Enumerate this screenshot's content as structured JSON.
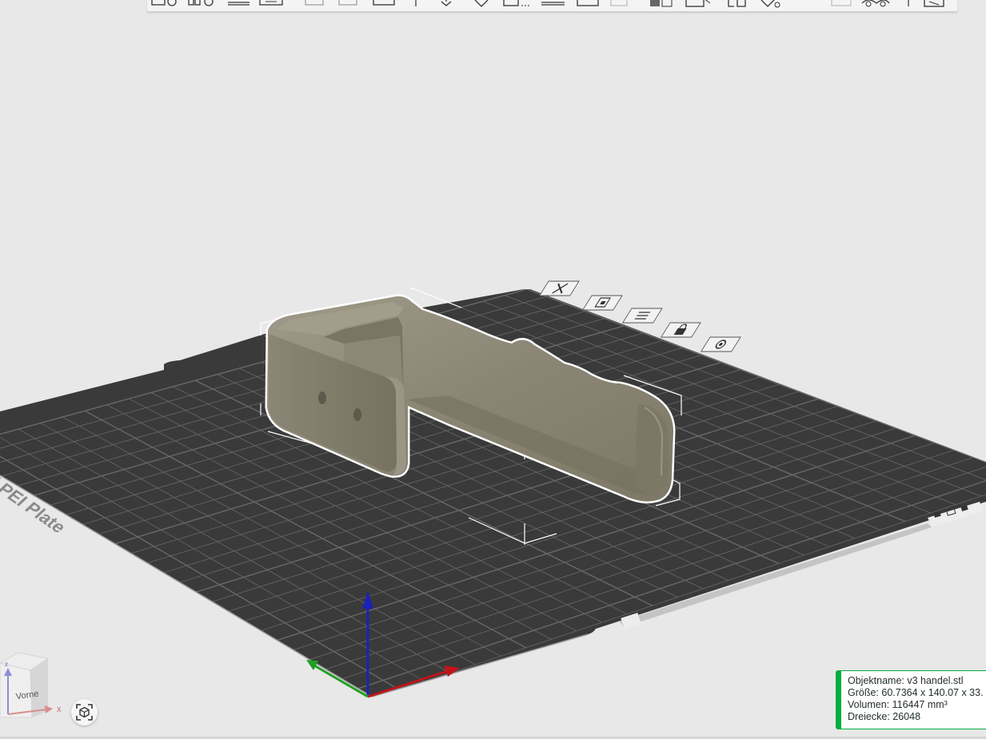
{
  "viewport": {
    "background": "#e8e8e8",
    "plate_label": "Bambu Textured PEI Plate",
    "plate_color": "#3a3a3a",
    "grid_color": "#6e6e6e",
    "model_color": "#8a8676",
    "selection_outline": "#ffffff"
  },
  "toolbar": {
    "items": [
      "add-icon",
      "add-plate-icon",
      "arrange-icon",
      "orient-icon",
      "split-objects-icon",
      "split-parts-icon",
      "layers-icon",
      "move-icon",
      "rotate-icon",
      "scale-icon",
      "lay-on-face-icon",
      "cut-icon",
      "support-paint-icon",
      "seam-paint-icon",
      "mesh-boolean-icon",
      "measure-icon",
      "text-icon",
      "svg-icon",
      "assembly-icon",
      "view-icon"
    ]
  },
  "plate_tools": [
    "delete-plate-icon",
    "arrange-plate-icon",
    "plate-settings-icon",
    "lock-plate-icon",
    "plate-options-icon"
  ],
  "view_cube": {
    "face_label": "Vorne",
    "axis_x": "x",
    "axis_z": "z"
  },
  "object_info": {
    "name_line": "Objektname: v3 handel.stl",
    "size_line": "Größe: 60.7364 x 140.07 x 33.",
    "volume_line": "Volumen: 116447 mm³",
    "triangles_line": "Dreiecke: 26048",
    "accent": "#00ae42"
  },
  "axes": {
    "x_color": "#c0141a",
    "y_color": "#1fa024",
    "z_color": "#1a22b8"
  }
}
